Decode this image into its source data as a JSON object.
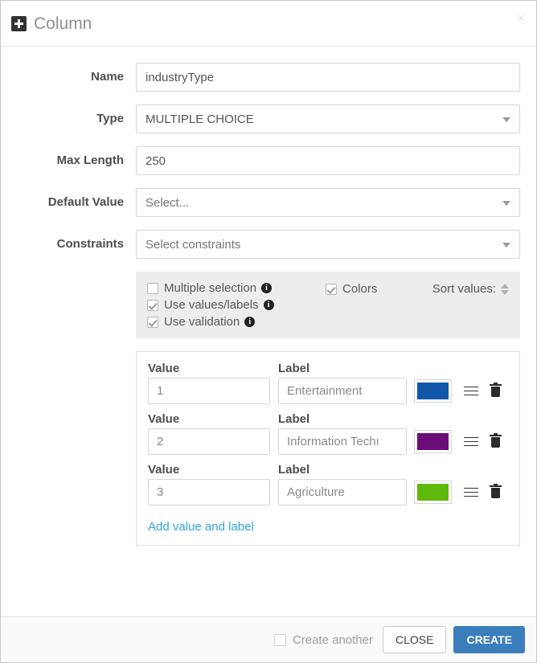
{
  "header": {
    "title": "Column",
    "icon": "plus-square-icon",
    "close": "×"
  },
  "form": {
    "name": {
      "label": "Name",
      "value": "industryType"
    },
    "type": {
      "label": "Type",
      "value": "MULTIPLE CHOICE"
    },
    "max_length": {
      "label": "Max Length",
      "value": "250"
    },
    "default_value": {
      "label": "Default Value",
      "placeholder": "Select..."
    },
    "constraints": {
      "label": "Constraints",
      "placeholder": "Select constraints"
    }
  },
  "options": {
    "multiple_selection": {
      "label": "Multiple selection",
      "checked": false,
      "info": "i"
    },
    "use_values_labels": {
      "label": "Use values/labels",
      "checked": true,
      "info": "i"
    },
    "use_validation": {
      "label": "Use validation",
      "checked": true,
      "info": "i"
    },
    "colors": {
      "label": "Colors",
      "checked": true
    },
    "sort_values": {
      "label": "Sort values:"
    }
  },
  "values": {
    "value_header": "Value",
    "label_header": "Label",
    "rows": [
      {
        "value": "1",
        "label": "Entertainment",
        "color": "#1256a8"
      },
      {
        "value": "2",
        "label": "Information Techı",
        "color": "#6b0d78"
      },
      {
        "value": "3",
        "label": "Agriculture",
        "color": "#5fb90d"
      }
    ],
    "add_link": "Add value and label"
  },
  "footer": {
    "create_another": {
      "label": "Create another",
      "checked": false
    },
    "close_label": "CLOSE",
    "create_label": "CREATE"
  },
  "colors": {
    "accent_blue": "#3b7ebc",
    "link_blue": "#2fa4e0",
    "panel_gray": "#ededed"
  }
}
